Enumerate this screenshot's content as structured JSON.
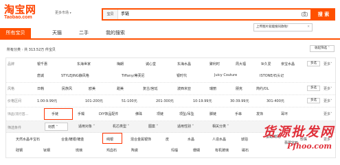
{
  "header": {
    "logo_main": "淘宝网",
    "logo_sub": "Taobao.com",
    "market_switch": "更多市场",
    "search_scope": "宝贝",
    "search_value": "手链",
    "search_button": "搜 索",
    "image_tip": "上传图片就能搜同款啦!"
  },
  "tabs": [
    "所有宝贝",
    "天猫",
    "二手",
    "我的搜索"
  ],
  "results": {
    "label": "所有分类",
    "text": "共 313.52万 件宝贝",
    "collapse": "收起筛选"
  },
  "filters": {
    "brand": {
      "label": "品牌",
      "row1": [
        "银千惠",
        "东海世家",
        "梅朗",
        "诚心堂",
        "东海水晶",
        "聚利时",
        "周大福",
        "9i久爱",
        "亲宝水晶"
      ],
      "row2": [
        "唐诚",
        "STYLEJING静风格",
        "Tiffany/蒂芙尼",
        "银时代",
        "Juicy Couture",
        "ISTONE/石头记"
      ],
      "more": "多选",
      "more2": "更多"
    },
    "style": {
      "label": "风格",
      "items": [
        "日韩",
        "民族风",
        "欧美",
        "甜美",
        "复古/宫廷",
        "波西米亚",
        "瑞丽",
        "朋克",
        "简约/OL"
      ],
      "more": "多选",
      "more2": "更多"
    },
    "price": {
      "label": "价格区间",
      "items": [
        "1.00-9.99元",
        "101-200元",
        "51-100元",
        "201-300元",
        "10-19.99元",
        "30-39.99元",
        "301-400元"
      ],
      "more": "多选",
      "more2": "更多"
    },
    "category": {
      "label": "饰品/流行首...",
      "items": [
        "手链",
        "手镯",
        "DIY饰品配件",
        "佛珠",
        "项链",
        "项坠/吊坠",
        "脚链",
        "手串",
        "发饰",
        "耳环"
      ],
      "more": "更多"
    },
    "screen": {
      "label": "筛选条件",
      "dropdowns": [
        "材质",
        "适用对象",
        "机芯类型",
        "图案",
        "适用性别",
        "相关分类"
      ]
    },
    "material": {
      "row1": [
        "天然水晶半宝石",
        "合金/镀银/镀金",
        "纯银",
        "混合金属银饰",
        "皮",
        "水晶",
        "人造水晶",
        "琥珀",
        "蜜蜡/琥珀",
        "珍珠"
      ],
      "row2": [
        "硅钢",
        "钛钢",
        "琉璃",
        "鸡血石",
        "陶瓷",
        "玛瑙",
        "珊瑚",
        "有机玻璃",
        "磁石"
      ],
      "extra": "翡翠宝石",
      "more": "更多"
    }
  },
  "watermark": {
    "main": "货源批发网",
    "sub": "Pfhoo.com"
  },
  "colors": {
    "accent": "#ff5000",
    "logo": "#ff4400",
    "highlight_box": "#ff3300"
  }
}
